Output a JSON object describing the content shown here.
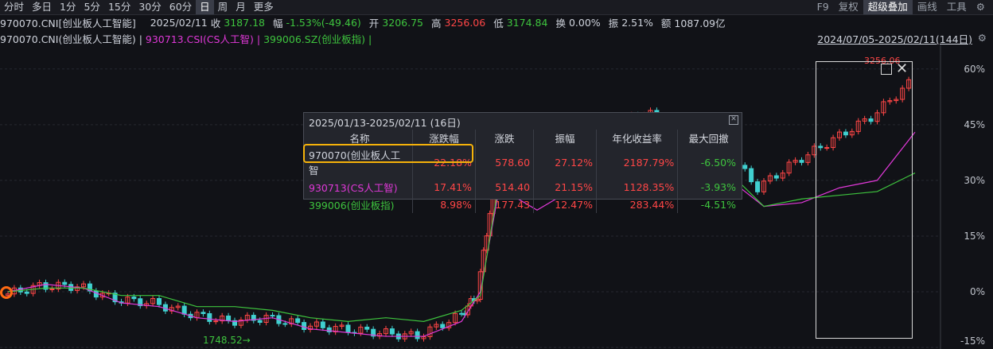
{
  "toolbar": {
    "left": [
      "分时",
      "多日",
      "1分",
      "5分",
      "15分",
      "30分",
      "60分",
      "日",
      "周",
      "月",
      "更多"
    ],
    "active": "日",
    "right": [
      "F9",
      "复权",
      "超级叠加",
      "画线",
      "工具"
    ]
  },
  "info": {
    "name": "970070.CNI[创业板人工智能]",
    "date": "2025/02/11",
    "close_label": "收",
    "close": "3187.18",
    "chg_label": "幅",
    "chg": "-1.53%(-49.46)",
    "open_label": "开",
    "open": "3206.75",
    "high_label": "高",
    "high": "3256.06",
    "low_label": "低",
    "low": "3174.84",
    "turnover_label": "换",
    "turnover": "0.00%",
    "amp_label": "振",
    "amp": "2.51%",
    "amount_label": "额",
    "amount": "1087.09亿"
  },
  "legend": {
    "s1": "970070.CNI(创业板人工智能)",
    "s2": "930713.CSI(CS人工智)",
    "s3": "399006.SZ(创业板指)",
    "range": "2024/07/05-2025/02/11(144日)"
  },
  "yaxis": [
    "60%",
    "45%",
    "30%",
    "15%",
    "0%",
    "-15%"
  ],
  "annotations": {
    "low": "1748.52",
    "high": "3256.06"
  },
  "popup": {
    "title": "2025/01/13-2025/02/11 (16日)",
    "headers": [
      "名称",
      "涨跌幅",
      "涨跌",
      "振幅",
      "年化收益率",
      "最大回撤"
    ],
    "rows": [
      {
        "name": "970070(创业板人工智",
        "pct": "22.18%",
        "chg": "578.60",
        "amp": "27.12%",
        "ann": "2187.79%",
        "dd": "-6.50%"
      },
      {
        "name": "930713(CS人工智)",
        "pct": "17.41%",
        "chg": "514.40",
        "amp": "21.15%",
        "ann": "1128.35%",
        "dd": "-3.93%"
      },
      {
        "name": "399006(创业板指)",
        "pct": "8.98%",
        "chg": "177.43",
        "amp": "12.47%",
        "ann": "283.44%",
        "dd": "-4.51%"
      }
    ]
  },
  "colors": {
    "up": "#ff4646",
    "down": "#40d0d0",
    "green": "#3ec43e",
    "magenta": "#e038d8",
    "highlight": "#f5b20a"
  },
  "chart_data": {
    "type": "line",
    "ylabel": "",
    "ylim": [
      -15,
      65
    ],
    "series": [
      {
        "name": "970070.CNI(创业板人工智能)",
        "style": "candles",
        "x": [
          0,
          10,
          20,
          30,
          40,
          50,
          60,
          70,
          80,
          90,
          100,
          110,
          120,
          125,
          130,
          140,
          150,
          160,
          170,
          180,
          190,
          200,
          210,
          220,
          230,
          240
        ],
        "values": [
          -1,
          1.5,
          1.5,
          -2,
          -3,
          -6,
          -8,
          -7,
          -9,
          -10,
          -11,
          -12,
          -7,
          -1,
          33,
          44,
          42,
          45,
          48,
          46,
          40,
          28,
          35,
          41,
          47,
          56
        ]
      },
      {
        "name": "930713.CSI(CS人工智)",
        "style": "line",
        "x": [
          0,
          10,
          20,
          30,
          40,
          50,
          60,
          70,
          80,
          90,
          100,
          110,
          120,
          125,
          130,
          140,
          150,
          160,
          170,
          180,
          190,
          200,
          210,
          220,
          230,
          240
        ],
        "values": [
          0,
          2,
          1,
          -3,
          -4,
          -7,
          -8,
          -7,
          -10,
          -11,
          -12,
          -12,
          -8,
          0,
          28,
          22,
          28,
          26,
          28,
          30,
          31,
          23,
          24,
          28,
          30,
          43
        ]
      },
      {
        "name": "399006.SZ(创业板指)",
        "style": "line",
        "x": [
          0,
          10,
          20,
          30,
          40,
          50,
          60,
          70,
          80,
          90,
          100,
          110,
          120,
          125,
          130,
          140,
          150,
          160,
          170,
          180,
          190,
          200,
          210,
          220,
          230,
          240
        ],
        "values": [
          0,
          1,
          1,
          -1,
          -1,
          -4,
          -4,
          -5,
          -7,
          -8,
          -7,
          -8,
          -5,
          -1,
          30,
          33,
          36,
          32,
          33,
          34,
          33,
          23,
          25,
          26,
          27,
          32
        ]
      }
    ]
  }
}
